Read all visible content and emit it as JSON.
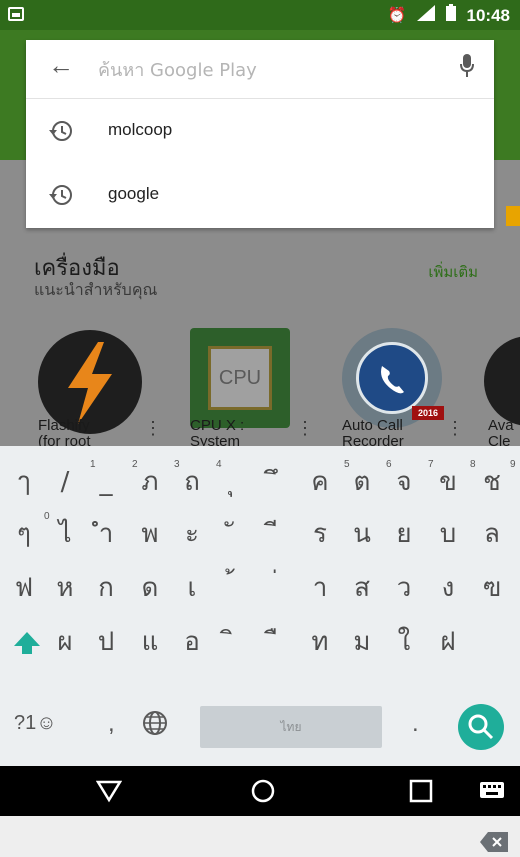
{
  "status_bar": {
    "time": "10:48",
    "icons": [
      "alarm-icon",
      "signal-icon",
      "battery-icon"
    ]
  },
  "search": {
    "placeholder": "ค้นหา Google Play",
    "suggestions": [
      {
        "icon": "history-icon",
        "text": "molcoop"
      },
      {
        "icon": "history-icon",
        "text": "google"
      }
    ]
  },
  "section": {
    "title": "เครื่องมือ",
    "subtitle": "แนะนำสำหรับคุณ",
    "more": "เพิ่มเติม",
    "apps": [
      {
        "name_line1": "Flashify",
        "name_line2": "(for root"
      },
      {
        "name_line1": "CPU X :",
        "name_line2": "System",
        "icon_text": "CPU"
      },
      {
        "name_line1": "Auto Call",
        "name_line2": "Recorder",
        "badge": "2016"
      },
      {
        "name_line1": "Ava",
        "name_line2": "Cle"
      }
    ]
  },
  "keyboard": {
    "row1": [
      "ๅ",
      "/",
      "_",
      "ภ",
      "ถ",
      "ุ",
      "ึ",
      "ค",
      "ต",
      "จ",
      "ข",
      "ช"
    ],
    "row1_hints": [
      "1",
      "2",
      "3",
      "4",
      "5",
      "6",
      "7",
      "8",
      "9"
    ],
    "row2": [
      "ๆ",
      "ไ",
      "ำ",
      "พ",
      "ะ",
      "ั",
      "ี",
      "ร",
      "น",
      "ย",
      "บ",
      "ล"
    ],
    "row2_hints": [
      "0"
    ],
    "row3": [
      "ฟ",
      "ห",
      "ก",
      "ด",
      "เ",
      "้",
      "่",
      "า",
      "ส",
      "ว",
      "ง",
      "ฃ"
    ],
    "row4": [
      "ผ",
      "ป",
      "แ",
      "อ",
      "ิ",
      "ื",
      "ท",
      "ม",
      "ใ",
      "ฝ"
    ],
    "symbols_key": "?1☺",
    "comma_key": ",",
    "period_key": ".",
    "space_label": "ไทย"
  }
}
